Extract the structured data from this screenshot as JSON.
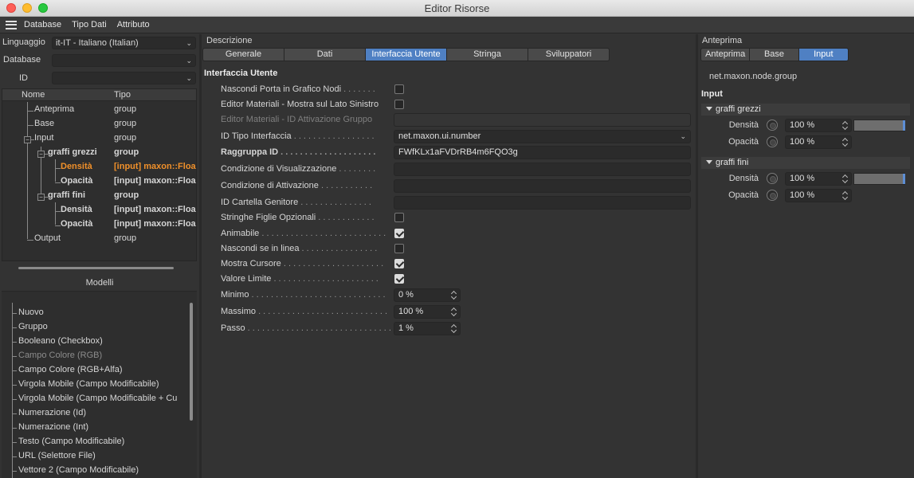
{
  "window": {
    "title": "Editor Risorse"
  },
  "menu": [
    "Database",
    "Tipo Dati",
    "Attributo"
  ],
  "left": {
    "language_label": "Linguaggio",
    "language_value": "it-IT - Italiano (Italian)",
    "database_label": "Database",
    "database_value": "",
    "id_label": "ID",
    "id_value": "",
    "tree_headers": {
      "name": "Nome",
      "type": "Tipo"
    },
    "tree": [
      {
        "name": "Anteprima",
        "type": "group"
      },
      {
        "name": "Base",
        "type": "group"
      },
      {
        "name": "Input",
        "type": "group"
      },
      {
        "name": "graffi grezzi",
        "type": "group"
      },
      {
        "name": "Densità",
        "type": "[input] maxon::Floa"
      },
      {
        "name": "Opacità",
        "type": "[input] maxon::Floa"
      },
      {
        "name": "graffi fini",
        "type": "group"
      },
      {
        "name": "Densità",
        "type": "[input] maxon::Floa"
      },
      {
        "name": "Opacità",
        "type": "[input] maxon::Floa"
      },
      {
        "name": "Output",
        "type": "group"
      }
    ],
    "models_title": "Modelli",
    "models": [
      "Nuovo",
      "Gruppo",
      "Booleano (Checkbox)",
      "Campo Colore (RGB)",
      "Campo Colore (RGB+Alfa)",
      "Virgola Mobile (Campo Modificabile)",
      "Virgola Mobile (Campo Modificabile + Cu",
      "Numerazione (Id)",
      "Numerazione (Int)",
      "Testo (Campo Modificabile)",
      "URL (Selettore File)",
      "Vettore 2 (Campo Modificabile)"
    ]
  },
  "middle": {
    "group_label": "Descrizione",
    "tabs": [
      "Generale",
      "Dati",
      "Interfaccia Utente",
      "Stringa",
      "Sviluppatori"
    ],
    "active_tab": "Interfaccia Utente",
    "section_title": "Interfaccia Utente",
    "rows": [
      {
        "label": "Nascondi Porta in Grafico Nodi",
        "dots": " . . . . . . .",
        "kind": "check",
        "checked": false
      },
      {
        "label": "Editor Materiali - Mostra sul Lato Sinistro",
        "dots": "",
        "kind": "check",
        "checked": false
      },
      {
        "label": "Editor Materiali - ID Attivazione Gruppo",
        "dots": "",
        "kind": "text",
        "value": "",
        "disabled": true
      },
      {
        "label": "ID Tipo Interfaccia",
        "dots": " . . . . . . . . . . . . . . . . .",
        "kind": "select",
        "value": "net.maxon.ui.number"
      },
      {
        "label": "Raggruppa ID",
        "dots": " . . . . . . . . . . . . . . . . . . . .",
        "kind": "text",
        "value": "FWfKLx1aFVDrRB4m6FQO3g",
        "bold": true
      },
      {
        "label": "Condizione di Visualizzazione",
        "dots": " . . . . . . . .",
        "kind": "text",
        "value": ""
      },
      {
        "label": "Condizione di Attivazione",
        "dots": " . . . . . . . . . . .",
        "kind": "text",
        "value": ""
      },
      {
        "label": "ID Cartella Genitore",
        "dots": " . . . . . . . . . . . . . . .",
        "kind": "text",
        "value": ""
      },
      {
        "label": "Stringhe Figlie Opzionali",
        "dots": " . . . . . . . . . . . .",
        "kind": "check",
        "checked": false
      },
      {
        "label": "Animabile",
        "dots": " . . . . . . . . . . . . . . . . . . . . . . . . . .",
        "kind": "check",
        "checked": true
      },
      {
        "label": "Nascondi se in linea",
        "dots": " . . . . . . . . . . . . . . . .",
        "kind": "check",
        "checked": false
      },
      {
        "label": "Mostra Cursore",
        "dots": " . . . . . . . . . . . . . . . . . . . . .",
        "kind": "check",
        "checked": true
      },
      {
        "label": "Valore Limite",
        "dots": " . . . . . . . . . . . . . . . . . . . . . .",
        "kind": "check",
        "checked": true
      },
      {
        "label": "Minimo",
        "dots": " . . . . . . . . . . . . . . . . . . . . . . . . . . . .",
        "kind": "number",
        "value": "0 %"
      },
      {
        "label": "Massimo",
        "dots": " . . . . . . . . . . . . . . . . . . . . . . . . . . .",
        "kind": "number",
        "value": "100 %"
      },
      {
        "label": "Passo",
        "dots": " . . . . . . . . . . . . . . . . . . . . . . . . . . . . . .",
        "kind": "number",
        "value": "1 %"
      }
    ]
  },
  "right": {
    "group_label": "Anteprima",
    "tabs": [
      "Anteprima",
      "Base",
      "Input"
    ],
    "active_tab": "Input",
    "node_id": "net.maxon.node.group",
    "section_title": "Input",
    "groups": [
      {
        "title": "graffi grezzi",
        "params": [
          {
            "label": "Densità",
            "value": "100 %",
            "slider": 1.0
          },
          {
            "label": "Opacità",
            "value": "100 %"
          }
        ]
      },
      {
        "title": "graffi fini",
        "params": [
          {
            "label": "Densità",
            "value": "100 %",
            "slider": 1.0
          },
          {
            "label": "Opacità",
            "value": "100 %"
          }
        ]
      }
    ]
  },
  "colors": {
    "accent": "#4f80c3",
    "selected_text": "#f0902a",
    "background": "#333333"
  }
}
